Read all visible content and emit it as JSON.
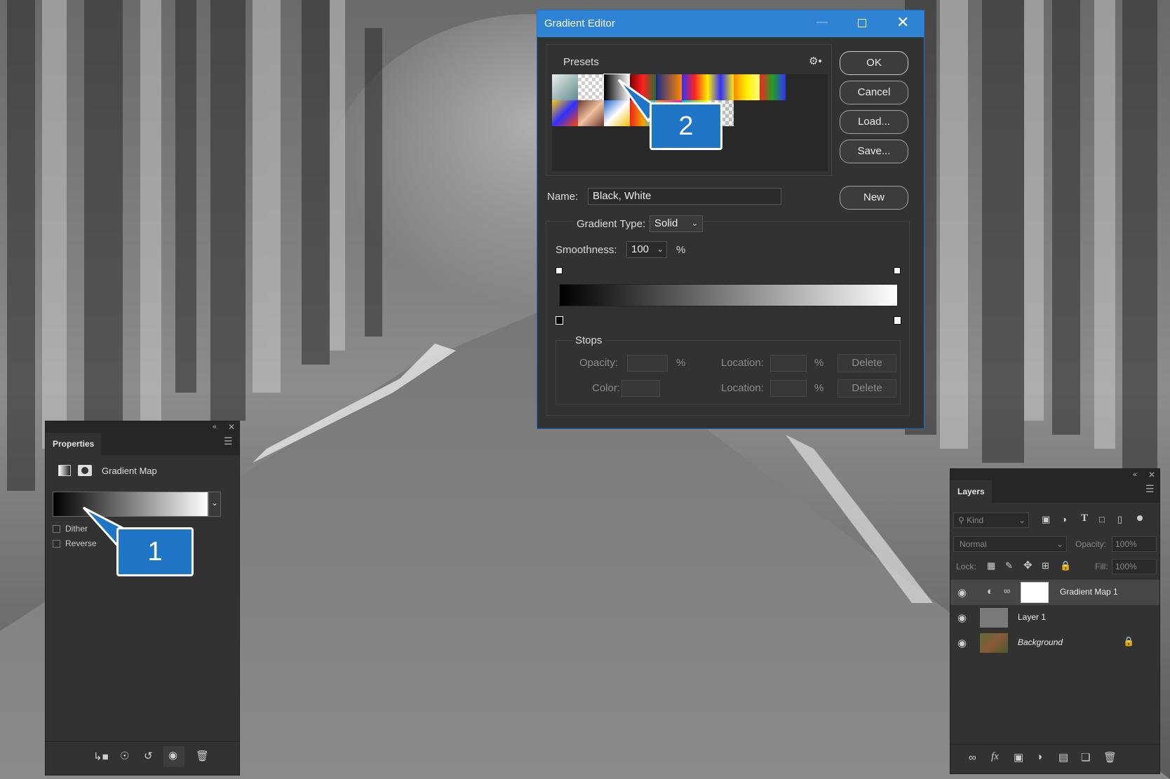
{
  "dialog": {
    "title": "Gradient Editor",
    "presets_label": "Presets",
    "buttons": {
      "ok": "OK",
      "cancel": "Cancel",
      "load": "Load...",
      "save": "Save...",
      "new": "New"
    },
    "name_label": "Name:",
    "name_value": "Black, White",
    "gradient_type_label": "Gradient Type:",
    "gradient_type_value": "Solid",
    "smoothness_label": "Smoothness:",
    "smoothness_value": "100",
    "percent": "%",
    "stops": {
      "label": "Stops",
      "opacity_label": "Opacity:",
      "color_label": "Color:",
      "location_label": "Location:",
      "delete_label": "Delete"
    }
  },
  "properties": {
    "tab": "Properties",
    "title": "Gradient Map",
    "dither_label": "Dither",
    "reverse_label": "Reverse"
  },
  "layers": {
    "tab": "Layers",
    "kind_label": "Kind",
    "blend_mode": "Normal",
    "opacity_label": "Opacity:",
    "opacity_value": "100%",
    "lock_label": "Lock:",
    "fill_label": "Fill:",
    "fill_value": "100%",
    "items": [
      {
        "name": "Gradient Map 1"
      },
      {
        "name": "Layer 1"
      },
      {
        "name": "Background"
      }
    ]
  },
  "callouts": {
    "one": "1",
    "two": "2"
  },
  "icons": {
    "close": "close-icon",
    "maximize": "maximize-icon",
    "minimize": "minimize-icon",
    "gear": "gear-icon",
    "eye": "eye-icon",
    "lock": "lock-icon",
    "link": "link-icon",
    "trash": "trash-icon",
    "fx": "fx-icon",
    "folder": "folder-icon"
  }
}
